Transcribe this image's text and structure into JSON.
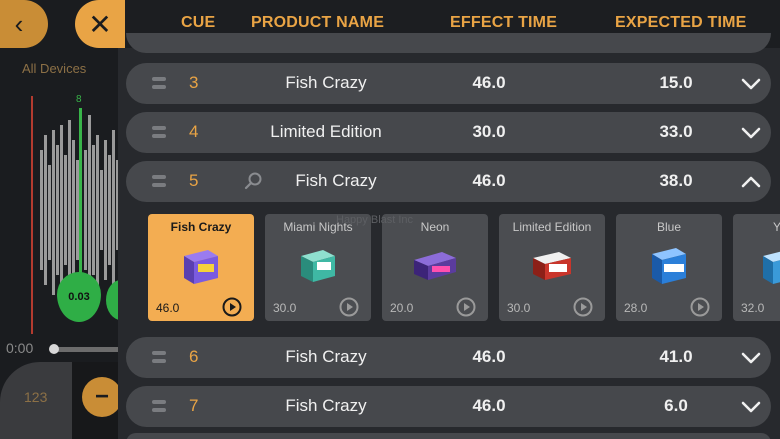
{
  "left": {
    "back_icon": "‹",
    "close_icon": "✕",
    "all_devices": "All Devices",
    "marker_number": "8",
    "marker_value": "0.03",
    "time_start": "0:00",
    "counter_value": "123",
    "minus_icon": "−"
  },
  "header": {
    "cue": "CUE",
    "product_name": "PRODUCT NAME",
    "effect_time": "EFFECT TIME",
    "expected_time": "EXPECTED TIME"
  },
  "rows": [
    {
      "cue": "3",
      "name": "Fish Crazy",
      "effect": "46.0",
      "expected": "15.0"
    },
    {
      "cue": "4",
      "name": "Limited Edition",
      "effect": "30.0",
      "expected": "33.0"
    },
    {
      "cue": "5",
      "name": "Fish Crazy",
      "effect": "46.0",
      "expected": "38.0"
    },
    {
      "cue": "6",
      "name": "Fish Crazy",
      "effect": "46.0",
      "expected": "41.0"
    },
    {
      "cue": "7",
      "name": "Fish Crazy",
      "effect": "46.0",
      "expected": "6.0"
    }
  ],
  "watermark": "Happy Blast Inc",
  "products": [
    {
      "name": "Fish Crazy",
      "time": "46.0",
      "selected": true,
      "color": "#7a5be0"
    },
    {
      "name": "Miami Nights",
      "time": "30.0",
      "selected": false,
      "color": "#3fb8a4"
    },
    {
      "name": "Neon",
      "time": "20.0",
      "selected": false,
      "color": "#5b3c9e"
    },
    {
      "name": "Limited Edition",
      "time": "30.0",
      "selected": false,
      "color": "#c9352b"
    },
    {
      "name": "Blue",
      "time": "28.0",
      "selected": false,
      "color": "#2b7fd9"
    },
    {
      "name": "Y",
      "time": "32.0",
      "selected": false,
      "color": "#3a9ad9"
    }
  ],
  "colors": {
    "accent": "#e9a445",
    "row_bg": "#46484c",
    "panel_bg": "#27292d"
  }
}
